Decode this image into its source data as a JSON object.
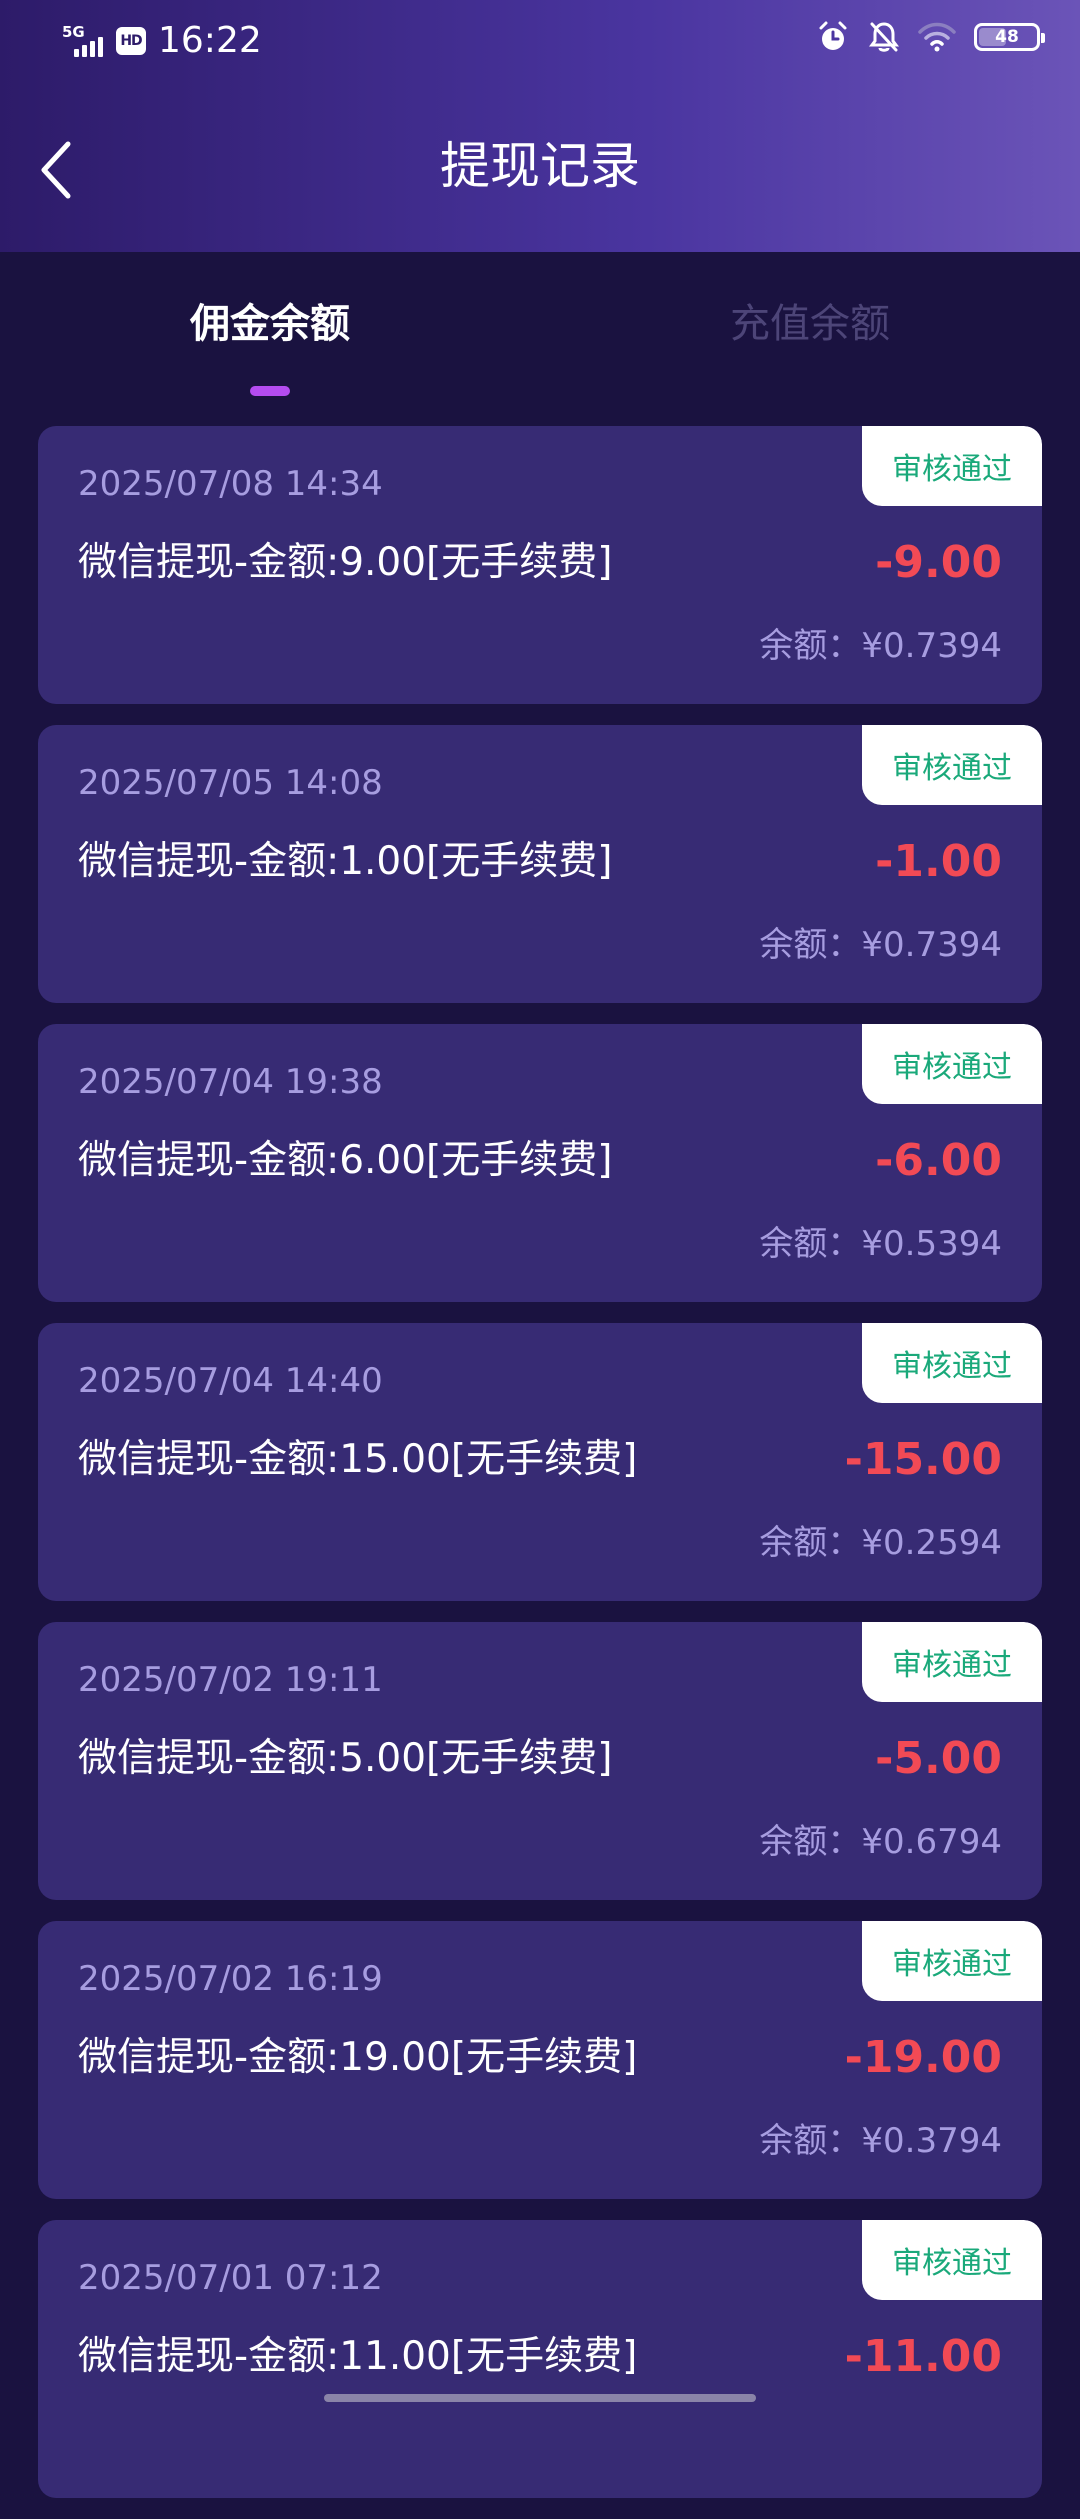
{
  "status_bar": {
    "network": "5G",
    "hd": "HD",
    "time": "16:22",
    "battery": "48",
    "battery_level": 0.48
  },
  "header": {
    "title": "提现记录"
  },
  "tabs": [
    {
      "label": "佣金余额",
      "active": true
    },
    {
      "label": "充值余额",
      "active": false
    }
  ],
  "records": [
    {
      "date": "2025/07/08 14:34",
      "desc": "微信提现-金额:9.00[无手续费]",
      "amount": "-9.00",
      "balance": "余额：¥0.7394",
      "status": "审核通过"
    },
    {
      "date": "2025/07/05 14:08",
      "desc": "微信提现-金额:1.00[无手续费]",
      "amount": "-1.00",
      "balance": "余额：¥0.7394",
      "status": "审核通过"
    },
    {
      "date": "2025/07/04 19:38",
      "desc": "微信提现-金额:6.00[无手续费]",
      "amount": "-6.00",
      "balance": "余额：¥0.5394",
      "status": "审核通过"
    },
    {
      "date": "2025/07/04 14:40",
      "desc": "微信提现-金额:15.00[无手续费]",
      "amount": "-15.00",
      "balance": "余额：¥0.2594",
      "status": "审核通过"
    },
    {
      "date": "2025/07/02 19:11",
      "desc": "微信提现-金额:5.00[无手续费]",
      "amount": "-5.00",
      "balance": "余额：¥0.6794",
      "status": "审核通过"
    },
    {
      "date": "2025/07/02 16:19",
      "desc": "微信提现-金额:19.00[无手续费]",
      "amount": "-19.00",
      "balance": "余额：¥0.3794",
      "status": "审核通过"
    },
    {
      "date": "2025/07/01 07:12",
      "desc": "微信提现-金额:11.00[无手续费]",
      "amount": "-11.00",
      "balance": "",
      "status": "审核通过"
    }
  ],
  "colors": {
    "header_start": "#2d1b69",
    "header_end": "#6b54b8",
    "background": "#1a1240",
    "card": "#372b74",
    "status_green": "#1aa97a",
    "amount_red": "#f24a55",
    "tab_indicator": "#b44cf0"
  },
  "icons": {
    "back": "chevron-left-icon",
    "alarm": "alarm-icon",
    "mute": "bell-off-icon",
    "wifi": "wifi-icon",
    "battery": "battery-icon",
    "signal": "signal-icon"
  }
}
